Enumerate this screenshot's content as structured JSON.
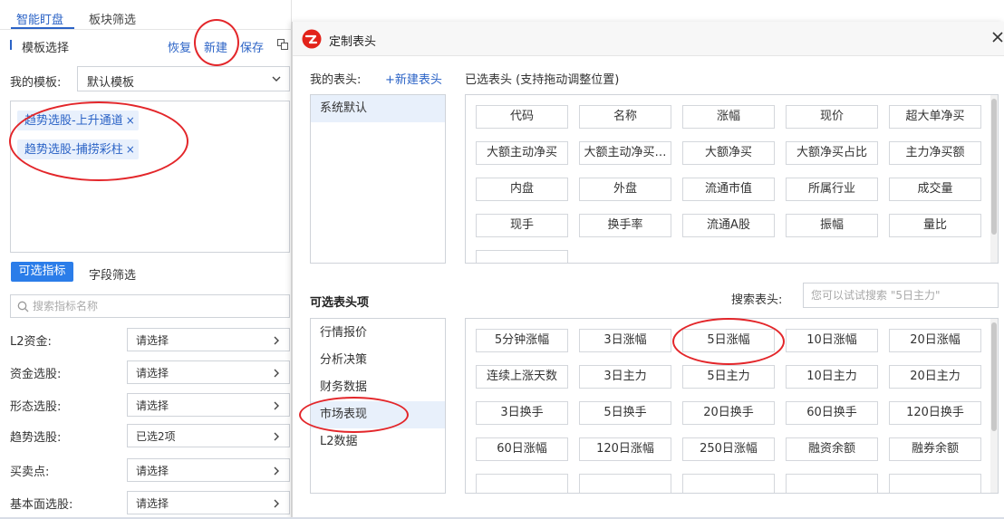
{
  "left": {
    "tabs": [
      "智能盯盘",
      "板块筛选"
    ],
    "template_title": "模板选择",
    "actions": {
      "restore": "恢复",
      "new": "新建",
      "save": "保存"
    },
    "my_template_label": "我的模板:",
    "my_template_value": "默认模板",
    "tags": [
      "趋势选股-上升通道",
      "趋势选股-捕捞彩柱"
    ],
    "tag_remove": "×",
    "sub_tabs": [
      "可选指标",
      "字段筛选"
    ],
    "search_placeholder": "搜索指标名称",
    "filters": [
      {
        "label": "L2资金:",
        "value": "请选择"
      },
      {
        "label": "资金选股:",
        "value": "请选择"
      },
      {
        "label": "形态选股:",
        "value": "请选择"
      },
      {
        "label": "趋势选股:",
        "value": "已选2项"
      },
      {
        "label": "买卖点:",
        "value": "请选择"
      },
      {
        "label": "基本面选股:",
        "value": "请选择"
      }
    ]
  },
  "dialog": {
    "title": "定制表头",
    "close_glyph": "×",
    "my_headers_label": "我的表头:",
    "new_header_link": "+新建表头",
    "my_headers": [
      "系统默认"
    ],
    "selected_label": "已选表头 (支持拖动调整位置)",
    "selected_items": [
      "代码",
      "名称",
      "涨幅",
      "现价",
      "超大单净买",
      "大额主动净买",
      "大额主动净买…",
      "大额净买",
      "大额净买占比",
      "主力净买额",
      "内盘",
      "外盘",
      "流通市值",
      "所属行业",
      "成交量",
      "现手",
      "换手率",
      "流通A股",
      "振幅",
      "量比"
    ],
    "optional_label": "可选表头项",
    "search_label": "搜索表头:",
    "search_placeholder": "您可以试试搜索 \"5日主力\"",
    "categories": [
      "行情报价",
      "分析决策",
      "财务数据",
      "市场表现",
      "L2数据"
    ],
    "selected_category": "市场表现",
    "optional_items": [
      "5分钟涨幅",
      "3日涨幅",
      "5日涨幅",
      "10日涨幅",
      "20日涨幅",
      "连续上涨天数",
      "3日主力",
      "5日主力",
      "10日主力",
      "20日主力",
      "3日换手",
      "5日换手",
      "20日换手",
      "60日换手",
      "120日换手",
      "60日涨幅",
      "120日涨幅",
      "250日涨幅",
      "融资余额",
      "融券余额"
    ]
  },
  "colors": {
    "accent": "#2b63c6",
    "active_tab_bg": "#2b7de9",
    "tag_bg": "#e8f0fc",
    "selected_row_bg": "#e8f0fb",
    "annotation": "#e3262a",
    "logo": "#e2231a"
  },
  "icons": [
    "copy-icon",
    "chevron-down-icon",
    "search-icon",
    "chevron-right-icon",
    "app-logo-icon",
    "close-icon"
  ]
}
